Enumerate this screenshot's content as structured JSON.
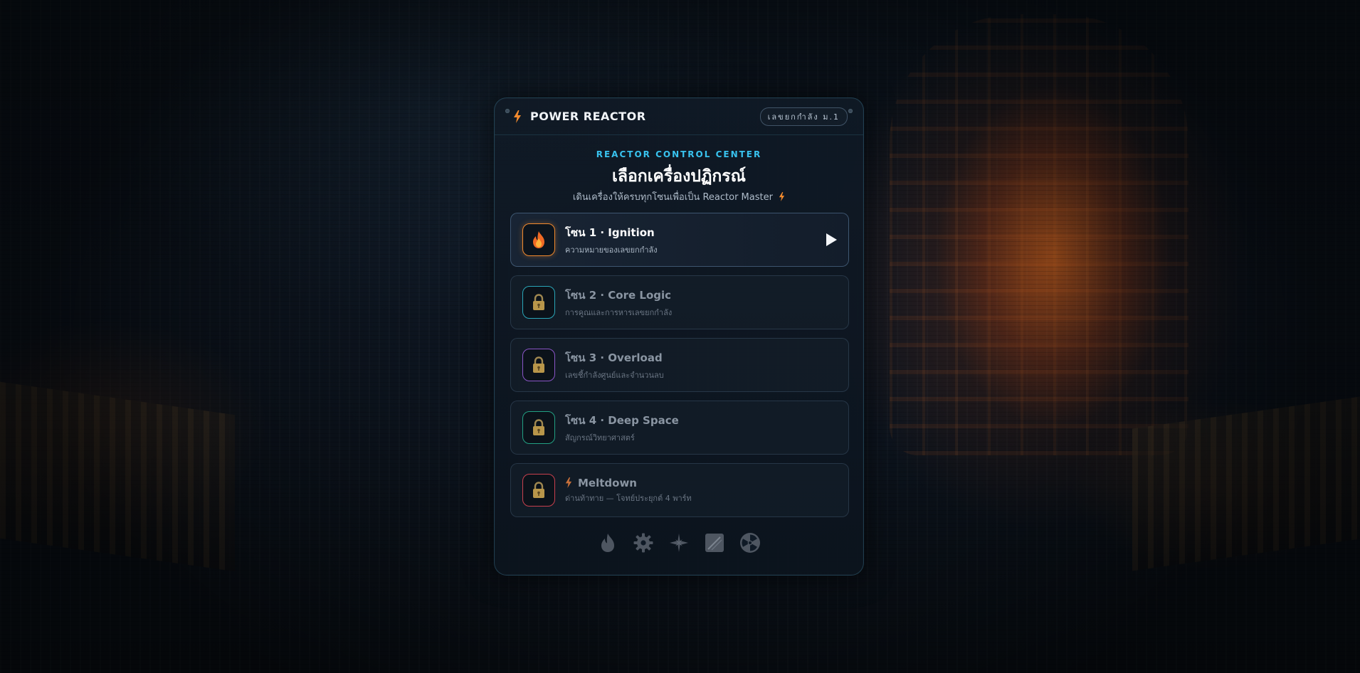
{
  "header": {
    "title": "POWER REACTOR",
    "badge": "เลขยกกำลัง ม.1"
  },
  "intro": {
    "eyebrow": "REACTOR CONTROL CENTER",
    "title": "เลือกเครื่องปฏิกรณ์",
    "subtitle": "เดินเครื่องให้ครบทุกโซนเพื่อเป็น Reactor Master"
  },
  "zones": [
    {
      "title": "โซน 1 · Ignition",
      "desc": "ความหมายของเลขยกกำลัง",
      "status": "unlocked",
      "icon": "flame-icon",
      "accent": "#f28a2e"
    },
    {
      "title": "โซน 2 · Core Logic",
      "desc": "การคูณและการหารเลขยกกำลัง",
      "status": "locked",
      "icon": "lock-icon",
      "accent": "#2aa6b8"
    },
    {
      "title": "โซน 3 · Overload",
      "desc": "เลขชี้กำลังศูนย์และจำนวนลบ",
      "status": "locked",
      "icon": "lock-icon",
      "accent": "#8a55c8"
    },
    {
      "title": "โซน 4 · Deep Space",
      "desc": "สัญกรณ์วิทยาศาสตร์",
      "status": "locked",
      "icon": "lock-icon",
      "accent": "#22a083"
    },
    {
      "title": "Meltdown",
      "desc": "ด่านท้าทาย — โจทย์ประยุกต์ 4 พาร์ท",
      "status": "locked",
      "icon": "lock-icon",
      "accent": "#c8404e"
    }
  ],
  "medals": [
    "flame-medal-icon",
    "gear-medal-icon",
    "spark-medal-icon",
    "comet-medal-icon",
    "radiation-medal-icon"
  ],
  "colors": {
    "accent_cyan": "#38c2ee",
    "accent_orange": "#f28a2e",
    "panel_bg": "#0f1a26",
    "medal_inactive": "#5a6370"
  }
}
